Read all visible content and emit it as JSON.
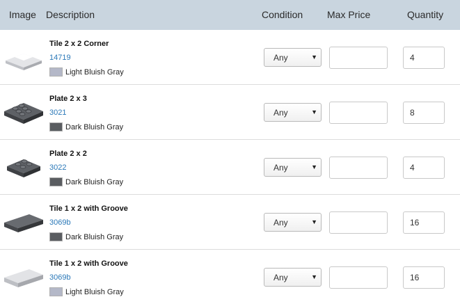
{
  "header": {
    "image": "Image",
    "description": "Description",
    "condition": "Condition",
    "max_price": "Max Price",
    "quantity": "Quantity"
  },
  "colors": {
    "light_bluish_gray": "#b4b8c8",
    "dark_bluish_gray": "#5a5d61",
    "link": "#2a78b8",
    "header_bg": "#c9d5df"
  },
  "rows": [
    {
      "name": "Tile 2 x 2 Corner",
      "part": "14719",
      "color": "Light Bluish Gray",
      "condition": "Any",
      "max_price": "",
      "quantity": "4",
      "icon": "tile-corner-icon"
    },
    {
      "name": "Plate 2 x 3",
      "part": "3021",
      "color": "Dark Bluish Gray",
      "condition": "Any",
      "max_price": "",
      "quantity": "8",
      "icon": "plate-2x3-icon"
    },
    {
      "name": "Plate 2 x 2",
      "part": "3022",
      "color": "Dark Bluish Gray",
      "condition": "Any",
      "max_price": "",
      "quantity": "4",
      "icon": "plate-2x2-icon"
    },
    {
      "name": "Tile 1 x 2 with Groove",
      "part": "3069b",
      "color": "Dark Bluish Gray",
      "condition": "Any",
      "max_price": "",
      "quantity": "16",
      "icon": "tile-1x2-icon"
    },
    {
      "name": "Tile 1 x 2 with Groove",
      "part": "3069b",
      "color": "Light Bluish Gray",
      "condition": "Any",
      "max_price": "",
      "quantity": "16",
      "icon": "tile-1x2-icon"
    }
  ]
}
